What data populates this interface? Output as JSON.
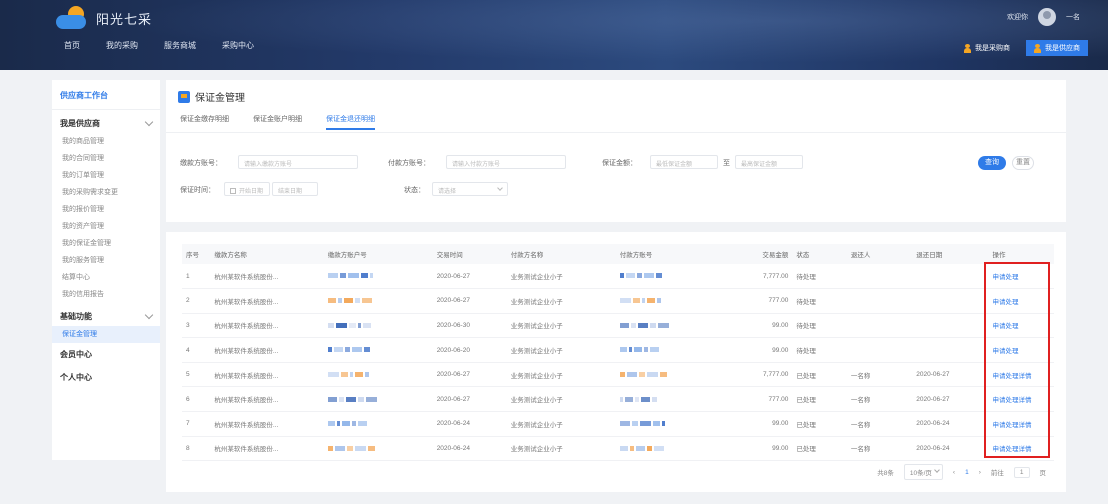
{
  "header": {
    "logo_text": "阳光七采",
    "nav": [
      "首页",
      "我的采购",
      "服务商城",
      "采购中心"
    ],
    "user_small": "欢迎你",
    "user_name": "一名",
    "quick_links": [
      "我是采购商",
      "我是供应商"
    ]
  },
  "sidebar": {
    "workspace_title": "供应商工作台",
    "group_title": "我是供应商",
    "items": [
      "我的商品管理",
      "我的合同管理",
      "我的订单管理",
      "我的采购需求变更",
      "我的报价管理",
      "我的资产管理",
      "我的保证金管理",
      "我的服务管理",
      "结算中心",
      "我的信用报告"
    ],
    "group2": "基础功能",
    "group2_items": [
      "保证金管理"
    ],
    "active_item": "保证金管理",
    "bottom_groups": [
      "会员中心",
      "个人中心"
    ]
  },
  "page": {
    "title": "保证金管理",
    "tabs": [
      "保证金缴存明细",
      "保证金账户明细",
      "保证金退还明细"
    ],
    "active_tab": 2
  },
  "filters": {
    "f1_label": "缴款方账号：",
    "f1_placeholder": "请输入缴款方账号",
    "f2_label": "付款方账号：",
    "f2_placeholder": "请输入付款方账号",
    "f3_label": "保证金额：",
    "f3_from": "最低保证金额",
    "f3_to": "最高保证金额",
    "f3_sep": "至",
    "f4_label": "保证时间：",
    "f4_from": "开始日期",
    "f4_to": "结束日期",
    "f5_label": "状态：",
    "f5_value": "请选择",
    "search": "查询",
    "reset": "重置"
  },
  "table": {
    "columns": [
      "序号",
      "缴款方名称",
      "缴款方账户号",
      "交易时间",
      "付款方名称",
      "付款方账号",
      "交易金额",
      "状态",
      "退还人",
      "退还日期",
      "操作"
    ],
    "rows": [
      {
        "no": "1",
        "name": "杭州某软件系统股份...",
        "date": "2020-06-27",
        "payer": "业务测试企业小子",
        "amount": "7,777.00",
        "status": "待处理",
        "refunder": "",
        "refund_date": "",
        "op": "申请处理"
      },
      {
        "no": "2",
        "name": "杭州某软件系统股份...",
        "date": "2020-06-27",
        "payer": "业务测试企业小子",
        "amount": "777.00",
        "status": "待处理",
        "refunder": "",
        "refund_date": "",
        "op": "申请处理"
      },
      {
        "no": "3",
        "name": "杭州某软件系统股份...",
        "date": "2020-06-30",
        "payer": "业务测试企业小子",
        "amount": "99.00",
        "status": "待处理",
        "refunder": "",
        "refund_date": "",
        "op": "申请处理"
      },
      {
        "no": "4",
        "name": "杭州某软件系统股份...",
        "date": "2020-06-20",
        "payer": "业务测试企业小子",
        "amount": "99.00",
        "status": "待处理",
        "refunder": "",
        "refund_date": "",
        "op": "申请处理"
      },
      {
        "no": "5",
        "name": "杭州某软件系统股份...",
        "date": "2020-06-27",
        "payer": "业务测试企业小子",
        "amount": "7,777.00",
        "status": "已处理",
        "refunder": "一名称",
        "refund_date": "2020-06-27",
        "op": "申请处理详情"
      },
      {
        "no": "6",
        "name": "杭州某软件系统股份...",
        "date": "2020-06-27",
        "payer": "业务测试企业小子",
        "amount": "777.00",
        "status": "已处理",
        "refunder": "一名称",
        "refund_date": "2020-06-27",
        "op": "申请处理详情"
      },
      {
        "no": "7",
        "name": "杭州某软件系统股份...",
        "date": "2020-06-24",
        "payer": "业务测试企业小子",
        "amount": "99.00",
        "status": "已处理",
        "refunder": "一名称",
        "refund_date": "2020-06-24",
        "op": "申请处理详情"
      },
      {
        "no": "8",
        "name": "杭州某软件系统股份...",
        "date": "2020-06-24",
        "payer": "业务测试企业小子",
        "amount": "99.00",
        "status": "已处理",
        "refunder": "一名称",
        "refund_date": "2020-06-24",
        "op": "申请处理详情"
      }
    ]
  },
  "pager": {
    "total": "共8条",
    "page_size": "10条/页",
    "prev": "‹",
    "current": "1",
    "next": "›",
    "goto": "前往",
    "goto_value": "1",
    "page_unit": "页"
  },
  "colors": {
    "accent": "#2f7be8",
    "highlight_box": "#e02020"
  }
}
